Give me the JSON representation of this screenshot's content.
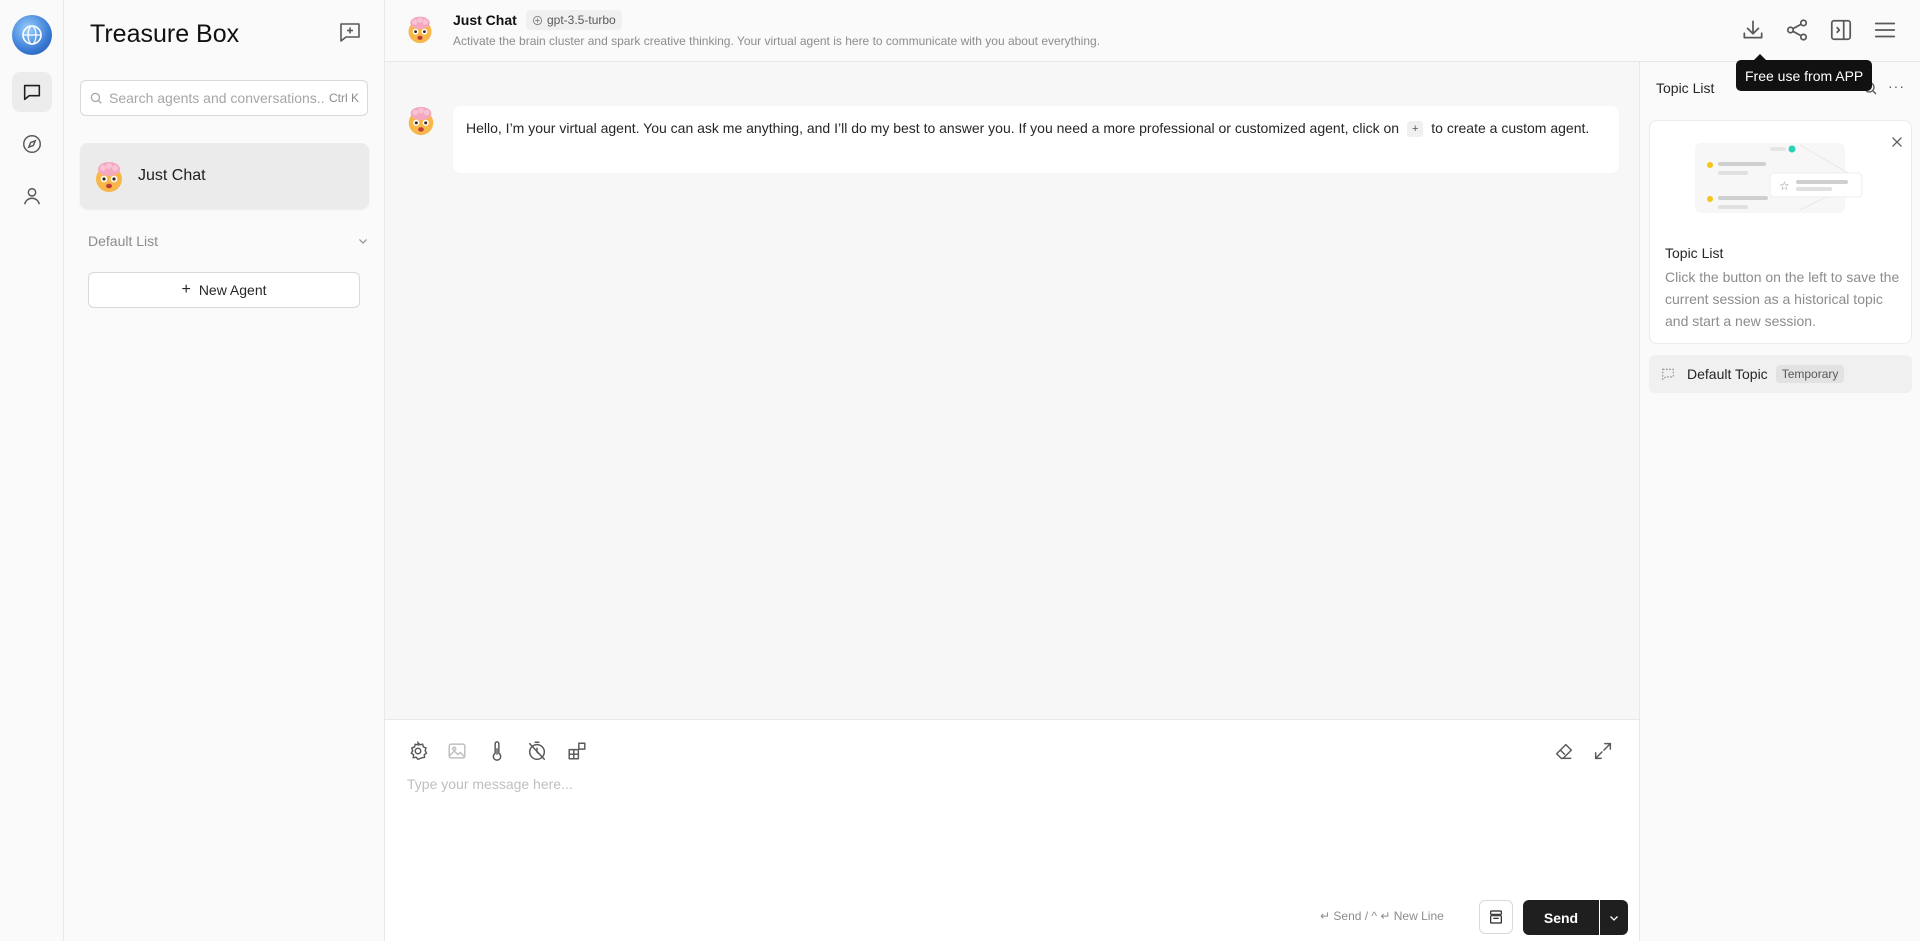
{
  "sidebar": {
    "title": "Treasure Box",
    "search_placeholder": "Search agents and conversations...",
    "search_shortcut": "Ctrl K",
    "sessions": [
      {
        "label": "Just Chat"
      }
    ],
    "group_label": "Default List",
    "new_agent_label": "New Agent"
  },
  "header": {
    "title": "Just Chat",
    "model": "gpt-3.5-turbo",
    "description": "Activate the brain cluster and spark creative thinking. Your virtual agent is here to communicate with you about everything.",
    "tooltip": "Free use from APP"
  },
  "chat": {
    "message_part1": "Hello, I’m your virtual agent. You can ask me anything, and I’ll do my best to answer you. If you need a more professional or customized agent, click on",
    "inline_button": "+",
    "message_part2": "to create a custom agent."
  },
  "input": {
    "placeholder": "Type your message here...",
    "hint": "↵ Send / ^ ↵ New Line",
    "send_label": "Send"
  },
  "topics": {
    "title": "Topic List",
    "guide_title": "Topic List",
    "guide_desc": "Click the button on the left to save the current session as a historical topic and start a new session.",
    "items": [
      {
        "label": "Default Topic",
        "badge": "Temporary"
      }
    ]
  },
  "colors": {
    "accent": "#1f1f1f",
    "tooltip_bg": "#111111"
  }
}
